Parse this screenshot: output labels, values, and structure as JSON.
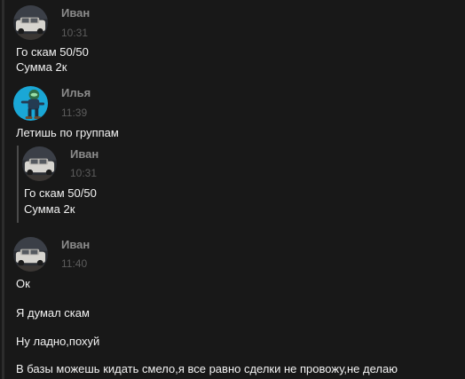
{
  "messages": [
    {
      "author": "Иван",
      "time": "10:31",
      "lines": [
        "Го скам 50/50",
        "Сумма 2к"
      ]
    },
    {
      "author": "Илья",
      "time": "11:39",
      "text": "Летишь по группам",
      "quote": {
        "author": "Иван",
        "time": "10:31",
        "lines": [
          "Го скам 50/50",
          "Сумма 2к"
        ]
      }
    },
    {
      "author": "Иван",
      "time": "11:40",
      "texts": [
        "Ок",
        "Я думал скам",
        "Ну ладно,похуй",
        "В базы можешь кидать смело,я все равно сделки не провожу,не делаю"
      ]
    }
  ],
  "avatars": {
    "ivan": "car-photo-avatar",
    "ilya": "cartoon-character-avatar"
  },
  "colors": {
    "background": "#181818",
    "author_name": "#8b8b8b",
    "timestamp": "#5c5c5c",
    "message_text": "#f2f2f2",
    "quote_bar": "#4a4a4a",
    "ilya_avatar_bg": "#1aa7d6"
  }
}
